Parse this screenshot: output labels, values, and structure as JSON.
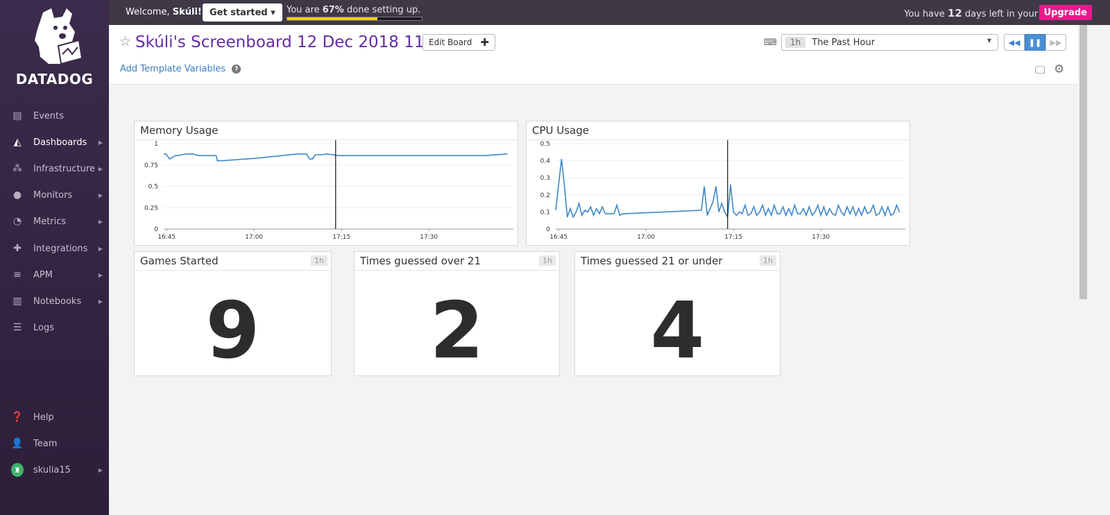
{
  "sidebar": {
    "brand": "DATADOG",
    "items": [
      {
        "label": "Events",
        "icon": "events-icon"
      },
      {
        "label": "Dashboards",
        "icon": "dashboards-icon"
      },
      {
        "label": "Infrastructure",
        "icon": "infrastructure-icon"
      },
      {
        "label": "Monitors",
        "icon": "monitors-icon"
      },
      {
        "label": "Metrics",
        "icon": "metrics-icon"
      },
      {
        "label": "Integrations",
        "icon": "integrations-icon"
      },
      {
        "label": "APM",
        "icon": "apm-icon"
      },
      {
        "label": "Notebooks",
        "icon": "notebooks-icon"
      },
      {
        "label": "Logs",
        "icon": "logs-icon"
      }
    ],
    "bottom": [
      {
        "label": "Help",
        "icon": "help-icon"
      },
      {
        "label": "Team",
        "icon": "team-icon"
      },
      {
        "label": "skulia15",
        "icon": "avatar"
      }
    ]
  },
  "topbar": {
    "welcome_prefix": "Welcome,",
    "welcome_name": "Skúli!",
    "get_started": "Get started ▾",
    "progress_prefix": "You are",
    "progress_pct": "67%",
    "progress_suffix": "done setting up.",
    "progress_value": 0.67,
    "trial_prefix": "You have",
    "trial_days": "12",
    "trial_suffix": "days left in your trial.",
    "upgrade": "Upgrade",
    "accent": "#e8198b"
  },
  "header": {
    "title": "Skúli's Screenboard 12 Dec 2018 11:22",
    "edit_board": "Edit Board",
    "add_template_vars": "Add Template Variables",
    "time_badge": "1h",
    "time_label": "The Past Hour"
  },
  "widgets": {
    "memory": {
      "title": "Memory Usage"
    },
    "cpu": {
      "title": "CPU Usage"
    },
    "games": {
      "title": "Games Started",
      "badge": "1h",
      "value": "9"
    },
    "over21": {
      "title": "Times guessed over 21",
      "badge": "1h",
      "value": "2"
    },
    "under21": {
      "title": "Times guessed 21 or under",
      "badge": "1h",
      "value": "4"
    }
  },
  "chart_data": [
    {
      "type": "line",
      "title": "Memory Usage",
      "x_ticks": [
        "16:45",
        "17:00",
        "17:15",
        "17:30"
      ],
      "y_ticks": [
        "0",
        "0.25",
        "0.5",
        "0.75",
        "1"
      ],
      "ylim": [
        0,
        1
      ],
      "xlim": [
        0,
        60
      ],
      "marker_x": 29.5,
      "color": "#3d88c9",
      "x": [
        0,
        0.4,
        1,
        1.5,
        2,
        2.5,
        3,
        4,
        5,
        6,
        7,
        8,
        9,
        9.2,
        10,
        16,
        23,
        24.5,
        25,
        25.5,
        26,
        27,
        28,
        30,
        35,
        40,
        45,
        50,
        55,
        59
      ],
      "y": [
        0.88,
        0.88,
        0.82,
        0.84,
        0.86,
        0.86,
        0.87,
        0.88,
        0.88,
        0.86,
        0.86,
        0.86,
        0.86,
        0.8,
        0.8,
        0.83,
        0.88,
        0.88,
        0.82,
        0.82,
        0.87,
        0.87,
        0.88,
        0.86,
        0.86,
        0.86,
        0.86,
        0.86,
        0.86,
        0.88
      ]
    },
    {
      "type": "line",
      "title": "CPU Usage",
      "x_ticks": [
        "16:45",
        "17:00",
        "17:15",
        "17:30"
      ],
      "y_ticks": [
        "0",
        "0.1",
        "0.2",
        "0.3",
        "0.4",
        "0.5"
      ],
      "ylim": [
        0,
        0.5
      ],
      "xlim": [
        0,
        60
      ],
      "marker_x": 29.5,
      "color": "#3d88c9",
      "x": [
        0,
        1,
        1.5,
        2,
        2.5,
        3,
        3.5,
        4,
        4.5,
        5,
        5.5,
        6,
        6.5,
        7,
        7.5,
        8,
        8.5,
        9,
        9.5,
        10,
        10.5,
        11,
        11.5,
        12,
        25,
        25.5,
        26,
        26.5,
        27,
        27.5,
        28,
        28.5,
        29,
        29.5,
        30,
        30.5,
        31,
        31.5,
        32,
        32.5,
        33,
        33.5,
        34,
        34.5,
        35,
        35.5,
        36,
        36.5,
        37,
        37.5,
        38,
        38.5,
        39,
        39.5,
        40,
        40.5,
        41,
        41.5,
        42,
        42.5,
        43,
        43.5,
        44,
        44.5,
        45,
        45.5,
        46,
        46.5,
        47,
        47.5,
        48,
        48.5,
        49,
        49.5,
        50,
        50.5,
        51,
        51.5,
        52,
        52.5,
        53,
        53.5,
        54,
        54.5,
        55,
        55.5,
        56,
        56.5,
        57,
        57.5,
        58,
        58.5,
        59
      ],
      "y": [
        0.11,
        0.41,
        0.25,
        0.07,
        0.12,
        0.07,
        0.1,
        0.15,
        0.08,
        0.11,
        0.1,
        0.13,
        0.08,
        0.12,
        0.09,
        0.13,
        0.09,
        0.09,
        0.09,
        0.09,
        0.14,
        0.08,
        0.09,
        0.09,
        0.11,
        0.25,
        0.08,
        0.12,
        0.16,
        0.25,
        0.1,
        0.15,
        0.1,
        0.07,
        0.26,
        0.1,
        0.08,
        0.1,
        0.09,
        0.14,
        0.08,
        0.09,
        0.13,
        0.08,
        0.1,
        0.14,
        0.08,
        0.12,
        0.08,
        0.14,
        0.09,
        0.09,
        0.13,
        0.08,
        0.12,
        0.08,
        0.14,
        0.09,
        0.09,
        0.12,
        0.08,
        0.13,
        0.08,
        0.1,
        0.14,
        0.08,
        0.13,
        0.08,
        0.12,
        0.09,
        0.08,
        0.14,
        0.1,
        0.08,
        0.13,
        0.09,
        0.13,
        0.08,
        0.12,
        0.08,
        0.13,
        0.09,
        0.1,
        0.14,
        0.08,
        0.09,
        0.13,
        0.08,
        0.13,
        0.08,
        0.09,
        0.14,
        0.1
      ]
    }
  ]
}
